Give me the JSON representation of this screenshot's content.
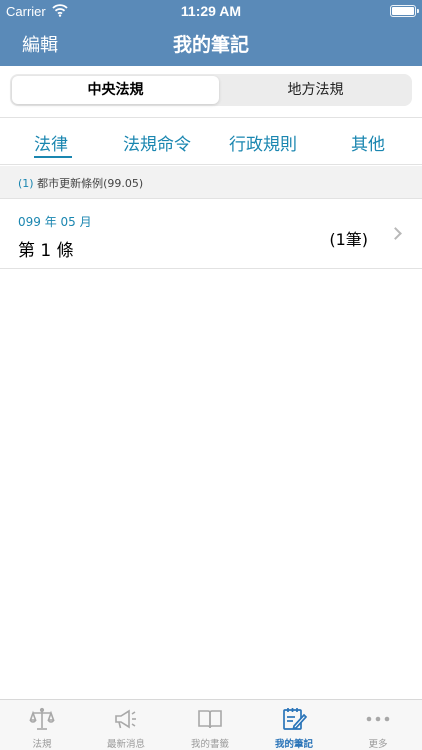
{
  "status_bar": {
    "carrier": "Carrier",
    "time": "11:29 AM"
  },
  "nav": {
    "edit_label": "編輯",
    "title": "我的筆記"
  },
  "segments": {
    "selected": "中央法規",
    "other": "地方法規"
  },
  "category_tabs": [
    {
      "label": "法律",
      "selected": true
    },
    {
      "label": "法規命令",
      "selected": false
    },
    {
      "label": "行政規則",
      "selected": false
    },
    {
      "label": "其他",
      "selected": false
    }
  ],
  "section": {
    "index": "(1)",
    "title": "都市更新條例(99.05)"
  },
  "note_row": {
    "date": "099 年 05 月",
    "title": "第 1 條",
    "count": "(1筆)"
  },
  "bottom_tabs": [
    {
      "label": "法規",
      "icon": "scale-icon",
      "active": false
    },
    {
      "label": "最新消息",
      "icon": "megaphone-icon",
      "active": false
    },
    {
      "label": "我的書籤",
      "icon": "book-icon",
      "active": false
    },
    {
      "label": "我的筆記",
      "icon": "notepad-icon",
      "active": true
    },
    {
      "label": "更多",
      "icon": "more-icon",
      "active": false
    }
  ],
  "colors": {
    "header": "#5a8ab8",
    "accent": "#1a86b0",
    "active_tab": "#2a74b8"
  }
}
